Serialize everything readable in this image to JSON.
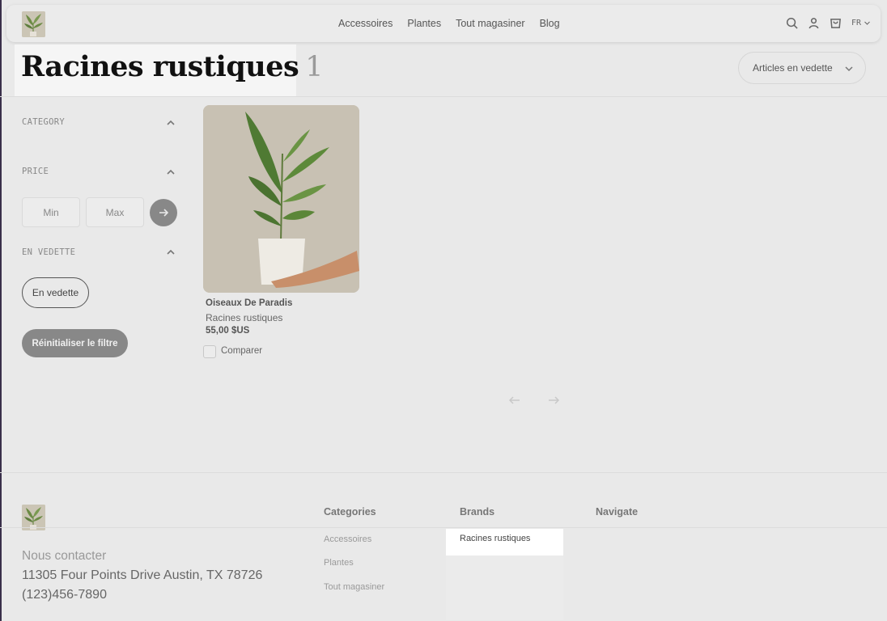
{
  "header": {
    "nav": [
      "Accessoires",
      "Plantes",
      "Tout magasiner",
      "Blog"
    ],
    "lang": "FR",
    "icons": [
      "search-icon",
      "user-icon",
      "cart-icon",
      "chevron-down-icon"
    ]
  },
  "page": {
    "title": "Racines rustiques",
    "count": "1",
    "sort_label": "Articles en vedette"
  },
  "filters": {
    "category_heading": "CATEGORY",
    "price_heading": "PRICE",
    "min_placeholder": "Min",
    "max_placeholder": "Max",
    "featured_heading": "EN VEDETTE",
    "featured_chip": "En vedette",
    "reset_label": "Réinitialiser le filtre"
  },
  "product": {
    "name": "Oiseaux De Paradis",
    "brand": "Racines rustiques",
    "price": "55,00 $US",
    "compare_label": "Comparer"
  },
  "footer": {
    "categories_heading": "Categories",
    "categories": [
      "Accessoires",
      "Plantes",
      "Tout magasiner"
    ],
    "brands_heading": "Brands",
    "brands": [
      "Racines rustiques"
    ],
    "navigate_heading": "Navigate",
    "contact_heading": "Nous contacter",
    "address": "11305 Four Points Drive Austin, TX 78726",
    "phone": "(123)456-7890"
  },
  "colors": {
    "background": "#e9e9e9",
    "accent_button": "#888888",
    "title": "#111111"
  }
}
